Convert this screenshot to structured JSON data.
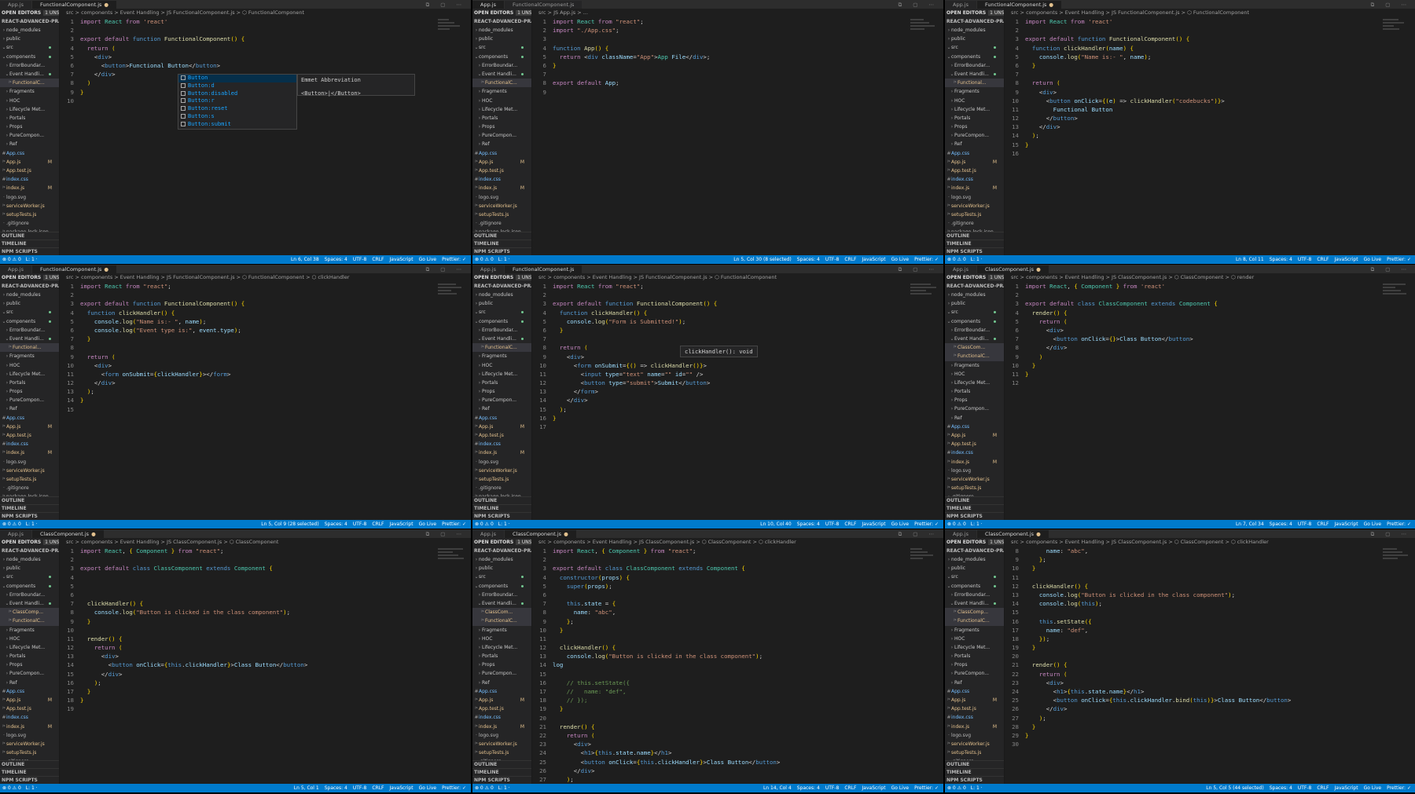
{
  "common": {
    "explorer_label": "OPEN EDITORS",
    "unsaved_badge": "1 UNSAVED",
    "project": "REACT-ADVANCED-PRACT...",
    "outline": "OUTLINE",
    "timeline": "TIMELINE",
    "npm_scripts": "NPM SCRIPTS",
    "status_left": [
      "⊗ 0 ⚠ 0",
      "L: 1 ·"
    ],
    "status_right_common": [
      "Spaces: 4",
      "UTF-8",
      "CRLF",
      "JavaScript",
      "Go Live",
      "Prettier: ✓"
    ],
    "colors": {
      "status": "#007acc",
      "editor": "#1e1e1e",
      "sidebar": "#252526"
    }
  },
  "panels": [
    {
      "tabs": [
        {
          "label": "App.js",
          "active": false
        },
        {
          "label": "FunctionalComponent.js",
          "active": true,
          "mod": "●"
        }
      ],
      "crumbs": "src > components > Event Handling > JS FunctionalComponent.js > ⬡ FunctionalComponent",
      "status_pos": "Ln 6, Col 38",
      "lines": [
        "1",
        "2",
        "3",
        "4",
        "5",
        "6",
        "7",
        "8",
        "9",
        "10"
      ],
      "code_text": [
        "import React from 'react'",
        "",
        "export default function FunctionalComponent() {",
        "  return (",
        "    <div>",
        "      <button>Functional Button</button>",
        "    </div>",
        "  )",
        "}",
        ""
      ],
      "suggest": [
        "Button",
        "Button:d",
        "Button:disabled",
        "Button:r",
        "Button:reset",
        "Button:s",
        "Button:submit"
      ],
      "suggest_head": "Emmet Abbreviation",
      "suggest_body": "<Button>|</Button>"
    },
    {
      "tabs": [
        {
          "label": "App.js",
          "active": true
        },
        {
          "label": "FunctionalComponent.js",
          "active": false
        }
      ],
      "crumbs": "src > JS App.js > ...",
      "status_pos": "Ln 5, Col 30 (8 selected)",
      "code_text": [
        "import React from \"react\";",
        "import \"./App.css\";",
        "",
        "function App() {",
        "  return <div className=\"App\">App File</div>;",
        "}",
        "",
        "export default App;",
        ""
      ],
      "lines": [
        "1",
        "2",
        "3",
        "4",
        "5",
        "6",
        "7",
        "8",
        "9"
      ]
    },
    {
      "tabs": [
        {
          "label": "App.js",
          "active": false
        },
        {
          "label": "FunctionalComponent.js",
          "active": true,
          "mod": "●"
        }
      ],
      "crumbs": "src > components > Event Handling > JS FunctionalComponent.js > ⬡ FunctionalComponent",
      "status_pos": "Ln 8, Col 11",
      "code_text": [
        "import React from 'react'",
        "",
        "export default function FunctionalComponent() {",
        "  function clickHandler(name) {",
        "    console.log(\"Name is:- \", name);",
        "  }",
        "",
        "  return (",
        "    <div>",
        "      <button onClick={(e) => clickHandler(\"codebucks\")}>",
        "        Functional Button",
        "      </button>",
        "    </div>",
        "  );",
        "}",
        ""
      ],
      "lines": [
        "1",
        "2",
        "3",
        "4",
        "5",
        "6",
        "7",
        "8",
        "9",
        "10",
        "11",
        "12",
        "13",
        "14",
        "15",
        "16"
      ]
    },
    {
      "tabs": [
        {
          "label": "App.js",
          "active": false
        },
        {
          "label": "FunctionalComponent.js",
          "active": true,
          "mod": "●"
        }
      ],
      "crumbs": "src > components > Event Handling > JS FunctionalComponent.js > ⬡ FunctionalComponent > ⬡ clickHandler",
      "status_pos": "Ln 5, Col 9 (28 selected)",
      "code_text": [
        "import React from \"react\";",
        "",
        "export default function FunctionalComponent() {",
        "  function clickHandler() {",
        "    console.log(\"Name is:- \", name);",
        "    console.log(\"Event type is:\", event.type);",
        "  }",
        "",
        "  return (",
        "    <div>",
        "      <form onSubmit={clickHandler}></form>",
        "    </div>",
        "  );",
        "}",
        ""
      ],
      "lines": [
        "1",
        "2",
        "3",
        "4",
        "5",
        "6",
        "7",
        "8",
        "9",
        "10",
        "11",
        "12",
        "13",
        "14",
        "15"
      ]
    },
    {
      "tabs": [
        {
          "label": "App.js",
          "active": false
        },
        {
          "label": "FunctionalComponent.js",
          "active": true
        }
      ],
      "crumbs": "src > components > Event Handling > JS FunctionalComponent.js > ⬡ FunctionalComponent",
      "status_pos": "Ln 10, Col 40",
      "code_text": [
        "import React from \"react\";",
        "",
        "export default function FunctionalComponent() {",
        "  function clickHandler() {",
        "    console.log(\"Form is Submitted!\");",
        "  }",
        "",
        "  return (",
        "    <div>",
        "      <form onSubmit={() => clickHandler()}>",
        "        <input type=\"text\" name=\"\" id=\"\" />",
        "        <button type=\"submit\">Submit</button>",
        "      </form>",
        "    </div>",
        "  );",
        "}",
        ""
      ],
      "lines": [
        "1",
        "2",
        "3",
        "4",
        "5",
        "6",
        "7",
        "8",
        "9",
        "10",
        "11",
        "12",
        "13",
        "14",
        "15",
        "16",
        "17"
      ],
      "hover": "clickHandler(): void"
    },
    {
      "tabs": [
        {
          "label": "App.js",
          "active": false
        },
        {
          "label": "ClassComponent.js",
          "active": true,
          "mod": "●"
        }
      ],
      "crumbs": "src > components > Event Handling > JS ClassComponent.js > ⬡ ClassComponent > ⬡ render",
      "status_pos": "Ln 7, Col 34",
      "code_text": [
        "import React, { Component } from 'react'",
        "",
        "export default class ClassComponent extends Component {",
        "  render() {",
        "    return (",
        "      <div>",
        "        <button onClick={}>Class Button</button>",
        "      </div>",
        "    )",
        "  }",
        "}",
        ""
      ],
      "lines": [
        "1",
        "2",
        "3",
        "4",
        "5",
        "6",
        "7",
        "8",
        "9",
        "10",
        "11",
        "12"
      ]
    },
    {
      "tabs": [
        {
          "label": "App.js",
          "active": false
        },
        {
          "label": "ClassComponent.js",
          "active": true,
          "mod": "●"
        }
      ],
      "crumbs": "src > components > Event Handling > JS ClassComponent.js > ⬡ ClassComponent",
      "status_pos": "Ln 5, Col 1",
      "code_text": [
        "import React, { Component } from \"react\";",
        "",
        "export default class ClassComponent extends Component {",
        "",
        "",
        "",
        "  clickHandler() {",
        "    console.log(\"Button is clicked in the class component\");",
        "  }",
        "",
        "  render() {",
        "    return (",
        "      <div>",
        "        <button onClick={this.clickHandler}>Class Button</button>",
        "      </div>",
        "    );",
        "  }",
        "}",
        ""
      ],
      "lines": [
        "1",
        "2",
        "3",
        "4",
        "5",
        "6",
        "7",
        "8",
        "9",
        "10",
        "11",
        "12",
        "13",
        "14",
        "15",
        "16",
        "17",
        "18",
        "19"
      ]
    },
    {
      "tabs": [
        {
          "label": "App.js",
          "active": false
        },
        {
          "label": "ClassComponent.js",
          "active": true,
          "mod": "●"
        }
      ],
      "crumbs": "src > components > Event Handling > JS ClassComponent.js > ⬡ ClassComponent > ⬡ clickHandler",
      "status_pos": "Ln 14, Col 4",
      "code_text": [
        "import React, { Component } from \"react\";",
        "",
        "export default class ClassComponent extends Component {",
        "  constructor(props) {",
        "    super(props);",
        "",
        "    this.state = {",
        "      name: \"abc\",",
        "    };",
        "  }",
        "",
        "  clickHandler() {",
        "    console.log(\"Button is clicked in the class component\");",
        "log",
        "",
        "    // this.setState({",
        "    //   name: \"def\",",
        "    // });",
        "  }",
        "",
        "  render() {",
        "    return (",
        "      <div>",
        "        <h1>{this.state.name}</h1>",
        "        <button onClick={this.clickHandler}>Class Button</button>",
        "      </div>",
        "    );"
      ],
      "lines": [
        "1",
        "2",
        "3",
        "4",
        "5",
        "6",
        "7",
        "8",
        "9",
        "10",
        "11",
        "12",
        "13",
        "14",
        "15",
        "16",
        "17",
        "18",
        "19",
        "20",
        "21",
        "22",
        "23",
        "24",
        "25",
        "26",
        "27"
      ]
    },
    {
      "tabs": [
        {
          "label": "App.js",
          "active": false
        },
        {
          "label": "ClassComponent.js",
          "active": true,
          "mod": "●"
        }
      ],
      "crumbs": "src > components > Event Handling > JS ClassComponent.js > ⬡ ClassComponent > ⬡ clickHandler",
      "status_pos": "Ln 5, Col 5 (44 selected)",
      "code_text": [
        "      name: \"abc\",",
        "    };",
        "  }",
        "",
        "  clickHandler() {",
        "    console.log(\"Button is clicked in the class component\");",
        "    console.log(this);",
        "",
        "    this.setState({",
        "      name: \"def\",",
        "    });",
        "  }",
        "",
        "  render() {",
        "    return (",
        "      <div>",
        "        <h1>{this.state.name}</h1>",
        "        <button onClick={this.clickHandler.bind(this)}>Class Button</button>",
        "      </div>",
        "    );",
        "  }",
        "}",
        ""
      ],
      "lines": [
        "8",
        "9",
        "10",
        "11",
        "12",
        "13",
        "14",
        "15",
        "16",
        "17",
        "18",
        "19",
        "20",
        "21",
        "22",
        "23",
        "24",
        "25",
        "26",
        "27",
        "28",
        "29",
        "30"
      ]
    }
  ],
  "sidebars": [
    [
      "node_modules",
      "public",
      "src",
      "components",
      "ErrorBoundar...",
      "Event Handli...",
      "FunctionalC...",
      "Fragments",
      "HOC",
      "Lifecycle Met...",
      "Portals",
      "Props",
      "PureCompon...",
      "Ref",
      "App.css",
      "App.js",
      "App.test.js",
      "index.css",
      "index.js",
      "logo.svg",
      "serviceWorker.js",
      "setupTests.js",
      ".gitignore",
      "package-lock.json"
    ],
    [
      "node_modules",
      "public",
      "src",
      "components",
      "ErrorBoundar...",
      "Event Handli...",
      "FunctionalC...",
      "Fragments",
      "HOC",
      "Lifecycle Met...",
      "Portals",
      "Props",
      "PureCompon...",
      "Ref",
      "App.css",
      "App.js",
      "App.test.js",
      "index.css",
      "index.js",
      "logo.svg",
      "serviceWorker.js",
      "setupTests.js",
      ".gitignore",
      "package-lock.json"
    ],
    [
      "node_modules",
      "public",
      "src",
      "components",
      "ErrorBoundar...",
      "Event Handli...",
      "Functional...",
      "Fragments",
      "HOC",
      "Lifecycle Met...",
      "Portals",
      "Props",
      "PureCompon...",
      "Ref",
      "App.css",
      "App.js",
      "App.test.js",
      "index.css",
      "index.js",
      "logo.svg",
      "serviceWorker.js",
      "setupTests.js",
      ".gitignore",
      "package-lock.json"
    ],
    [
      "node_modules",
      "public",
      "src",
      "components",
      "ErrorBoundar...",
      "Event Handli...",
      "Functional...",
      "Fragments",
      "HOC",
      "Lifecycle Met...",
      "Portals",
      "Props",
      "PureCompon...",
      "Ref",
      "App.css",
      "App.js",
      "App.test.js",
      "index.css",
      "index.js",
      "logo.svg",
      "serviceWorker.js",
      "setupTests.js",
      ".gitignore",
      "package-lock.json"
    ],
    [
      "node_modules",
      "public",
      "src",
      "components",
      "ErrorBoundar...",
      "Event Handli...",
      "FunctionalC...",
      "Fragments",
      "HOC",
      "Lifecycle Met...",
      "Portals",
      "Props",
      "PureCompon...",
      "Ref",
      "App.css",
      "App.js",
      "App.test.js",
      "index.css",
      "index.js",
      "logo.svg",
      "serviceWorker.js",
      "setupTests.js",
      ".gitignore",
      "package-lock.json"
    ],
    [
      "node_modules",
      "public",
      "src",
      "components",
      "ErrorBoundar...",
      "Event Handli...",
      "ClassCom...",
      "FunctionalC...",
      "Fragments",
      "HOC",
      "Lifecycle Met...",
      "Portals",
      "Props",
      "PureCompon...",
      "Ref",
      "App.css",
      "App.js",
      "App.test.js",
      "index.css",
      "index.js",
      "logo.svg",
      "serviceWorker.js",
      "setupTests.js",
      ".gitignore"
    ],
    [
      "node_modules",
      "public",
      "src",
      "components",
      "ErrorBoundar...",
      "Event Handli...",
      "ClassComp...",
      "FunctionalC...",
      "Fragments",
      "HOC",
      "Lifecycle Met...",
      "Portals",
      "Props",
      "PureCompon...",
      "Ref",
      "App.css",
      "App.js",
      "App.test.js",
      "index.css",
      "index.js",
      "logo.svg",
      "serviceWorker.js",
      "setupTests.js",
      ".gitignore"
    ],
    [
      "node_modules",
      "public",
      "src",
      "components",
      "ErrorBoundar...",
      "Event Handli...",
      "ClassCom...",
      "FunctionalC...",
      "Fragments",
      "HOC",
      "Lifecycle Met...",
      "Portals",
      "Props",
      "PureCompon...",
      "Ref",
      "App.css",
      "App.js",
      "App.test.js",
      "index.css",
      "index.js",
      "logo.svg",
      "serviceWorker.js",
      "setupTests.js",
      ".gitignore"
    ],
    [
      "node_modules",
      "public",
      "src",
      "components",
      "ErrorBoundar...",
      "Event Handli...",
      "ClassComp...",
      "FunctionalC...",
      "Fragments",
      "HOC",
      "Lifecycle Met...",
      "Portals",
      "Props",
      "PureCompon...",
      "Ref",
      "App.css",
      "App.js",
      "App.test.js",
      "index.css",
      "index.js",
      "logo.svg",
      "serviceWorker.js",
      "setupTests.js",
      ".gitignore"
    ]
  ]
}
